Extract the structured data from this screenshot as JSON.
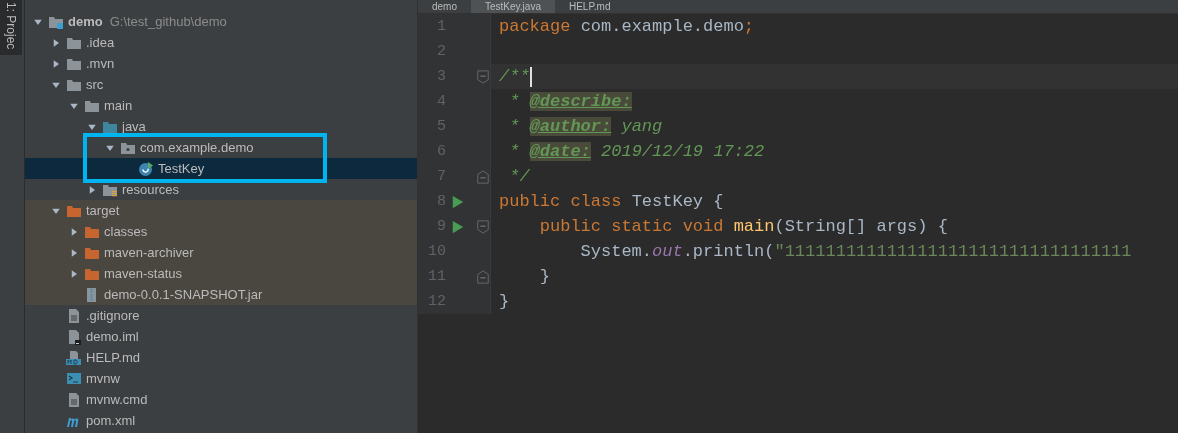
{
  "tool_strip": {
    "label": "1: Projec"
  },
  "project_tree": {
    "items": [
      {
        "kind": "module",
        "label": "demo",
        "path": "G:\\test_github\\demo",
        "expanded": true,
        "selected": false,
        "excluded": false,
        "children": [
          {
            "kind": "folder",
            "label": ".idea",
            "expanded": false,
            "selected": false,
            "excluded": false
          },
          {
            "kind": "folder",
            "label": ".mvn",
            "expanded": false,
            "selected": false,
            "excluded": false
          },
          {
            "kind": "folder",
            "label": "src",
            "expanded": true,
            "selected": false,
            "excluded": false,
            "children": [
              {
                "kind": "folder",
                "label": "main",
                "expanded": true,
                "selected": false,
                "excluded": false,
                "children": [
                  {
                    "kind": "source_root",
                    "label": "java",
                    "expanded": true,
                    "selected": false,
                    "excluded": false,
                    "children": [
                      {
                        "kind": "package",
                        "label": "com.example.demo",
                        "expanded": true,
                        "selected": false,
                        "excluded": false,
                        "children": [
                          {
                            "kind": "class",
                            "label": "TestKey",
                            "selected": true,
                            "excluded": false
                          }
                        ]
                      }
                    ]
                  },
                  {
                    "kind": "resources_root",
                    "label": "resources",
                    "expanded": false,
                    "selected": false,
                    "excluded": false
                  }
                ]
              }
            ]
          },
          {
            "kind": "excluded_folder",
            "label": "target",
            "expanded": true,
            "selected": false,
            "excluded": true,
            "children": [
              {
                "kind": "excluded_folder",
                "label": "classes",
                "expanded": false,
                "selected": false,
                "excluded": true
              },
              {
                "kind": "excluded_folder",
                "label": "maven-archiver",
                "expanded": false,
                "selected": false,
                "excluded": true
              },
              {
                "kind": "excluded_folder",
                "label": "maven-status",
                "expanded": false,
                "selected": false,
                "excluded": true
              },
              {
                "kind": "archive",
                "label": "demo-0.0.1-SNAPSHOT.jar",
                "selected": false,
                "excluded": true
              }
            ]
          },
          {
            "kind": "file",
            "label": ".gitignore",
            "selected": false,
            "excluded": false
          },
          {
            "kind": "module_file",
            "label": "demo.iml",
            "selected": false,
            "excluded": false
          },
          {
            "kind": "markdown",
            "label": "HELP.md",
            "selected": false,
            "excluded": false
          },
          {
            "kind": "script",
            "label": "mvnw",
            "selected": false,
            "excluded": false
          },
          {
            "kind": "file",
            "label": "mvnw.cmd",
            "selected": false,
            "excluded": false
          },
          {
            "kind": "maven",
            "label": "pom.xml",
            "selected": false,
            "excluded": false
          }
        ]
      }
    ]
  },
  "editor_tabs": [
    {
      "label": "demo",
      "selected": false
    },
    {
      "label": "TestKey.java",
      "selected": true
    },
    {
      "label": "HELP.md",
      "selected": false
    }
  ],
  "editor": {
    "lines": [
      {
        "number": "1",
        "current": false,
        "run": false,
        "fold_start": false,
        "fold_end": false,
        "tokens": [
          {
            "kind": "keyword",
            "text": "package "
          },
          {
            "kind": "plain",
            "text": "com.example.demo"
          },
          {
            "kind": "keyword",
            "text": ";"
          }
        ]
      },
      {
        "number": "2",
        "current": false,
        "run": false,
        "fold_start": false,
        "fold_end": false
      },
      {
        "number": "3",
        "current": true,
        "run": false,
        "fold_start": true,
        "fold_end": false,
        "tokens": [
          {
            "kind": "comment",
            "text": "/**"
          }
        ]
      },
      {
        "number": "4",
        "current": false,
        "run": false,
        "fold_start": false,
        "fold_end": false,
        "tokens": [
          {
            "kind": "comment",
            "text": " * "
          },
          {
            "kind": "doc_tag",
            "text": "@describe:"
          }
        ]
      },
      {
        "number": "5",
        "current": false,
        "run": false,
        "fold_start": false,
        "fold_end": false,
        "tokens": [
          {
            "kind": "comment",
            "text": " * "
          },
          {
            "kind": "doc_tag",
            "text": "@author:"
          },
          {
            "kind": "comment_italic",
            "text": " yang"
          }
        ]
      },
      {
        "number": "6",
        "current": false,
        "run": false,
        "fold_start": false,
        "fold_end": false,
        "tokens": [
          {
            "kind": "comment",
            "text": " * "
          },
          {
            "kind": "doc_tag",
            "text": "@date:"
          },
          {
            "kind": "comment_italic",
            "text": " 2019/12/19 17:22"
          }
        ]
      },
      {
        "number": "7",
        "current": false,
        "run": false,
        "fold_start": false,
        "fold_end": true,
        "tokens": [
          {
            "kind": "comment",
            "text": " */"
          }
        ]
      },
      {
        "number": "8",
        "current": false,
        "run": true,
        "fold_start": false,
        "fold_end": false,
        "tokens": [
          {
            "kind": "keyword",
            "text": "public class "
          },
          {
            "kind": "plain",
            "text": "TestKey {"
          }
        ]
      },
      {
        "number": "9",
        "current": false,
        "run": true,
        "fold_start": true,
        "fold_end": false,
        "tokens": [
          {
            "kind": "keyword",
            "text": "    public static void "
          },
          {
            "kind": "method",
            "text": "main"
          },
          {
            "kind": "plain",
            "text": "(String[] args) {"
          }
        ]
      },
      {
        "number": "10",
        "current": false,
        "run": false,
        "fold_start": false,
        "fold_end": false,
        "tokens": [
          {
            "kind": "plain",
            "text": "        System."
          },
          {
            "kind": "static_field",
            "text": "out"
          },
          {
            "kind": "plain",
            "text": ".println("
          },
          {
            "kind": "string",
            "text": "\"1111111111111111111111111111111111"
          }
        ]
      },
      {
        "number": "11",
        "current": false,
        "run": false,
        "fold_start": false,
        "fold_end": true,
        "tokens": [
          {
            "kind": "plain",
            "text": "    }"
          }
        ]
      },
      {
        "number": "12",
        "current": false,
        "run": false,
        "fold_start": false,
        "fold_end": false,
        "tokens": [
          {
            "kind": "plain",
            "text": "}"
          }
        ]
      }
    ]
  }
}
